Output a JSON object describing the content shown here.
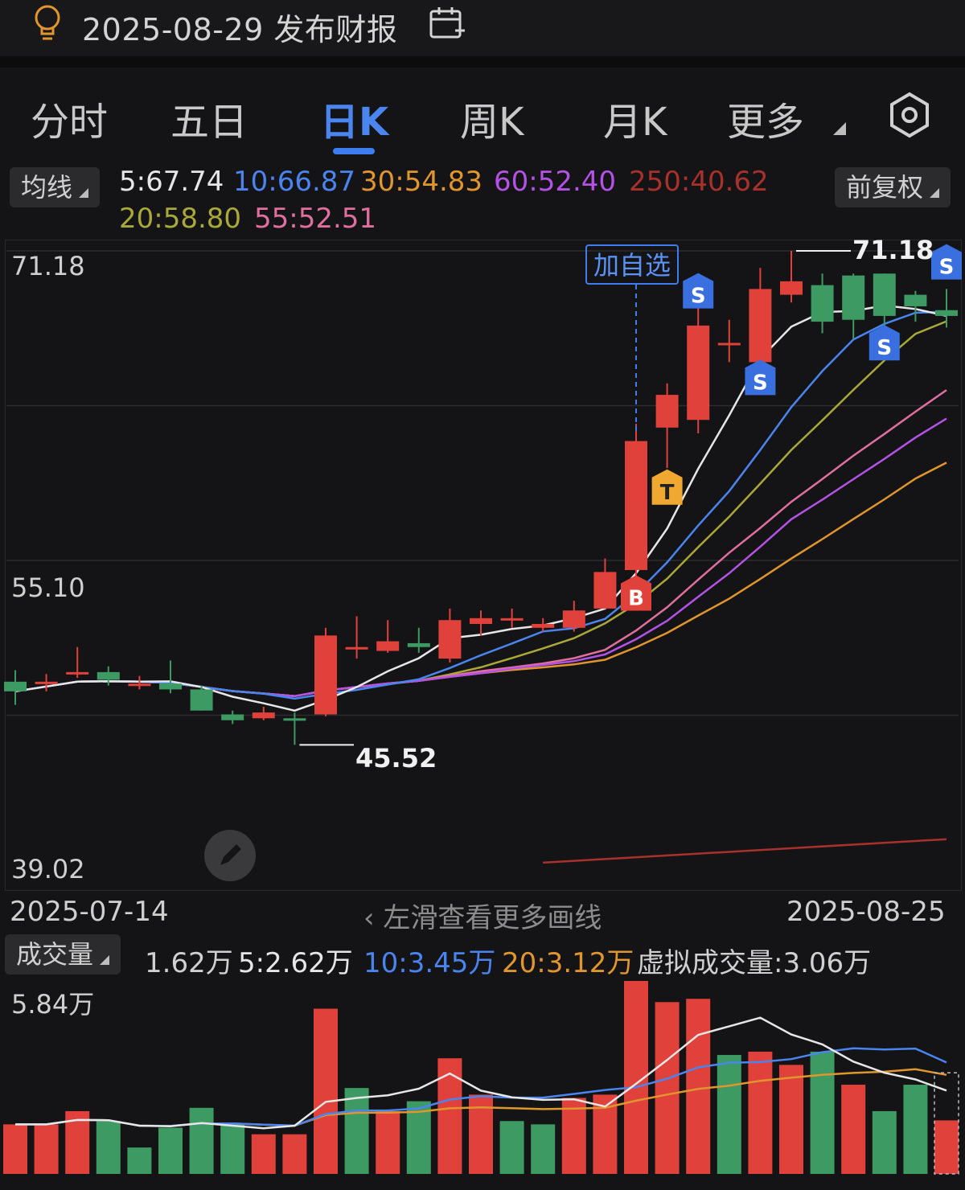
{
  "header": {
    "report_text": "2025-08-29 发布财报"
  },
  "tabs": [
    {
      "label": "分时"
    },
    {
      "label": "五日"
    },
    {
      "label": "日K"
    },
    {
      "label": "周K"
    },
    {
      "label": "月K"
    },
    {
      "label": "更多"
    }
  ],
  "ma": {
    "selector_label": "均线",
    "values": [
      {
        "text": "5:67.74",
        "color": "#e6e6e6"
      },
      {
        "text": "10:66.87",
        "color": "#4a84ee"
      },
      {
        "text": "30:54.83",
        "color": "#e0962c"
      },
      {
        "text": "60:52.40",
        "color": "#b452e6"
      },
      {
        "text": "250:40.62",
        "color": "#a8312c"
      },
      {
        "text": "20:58.80",
        "color": "#aaa838"
      },
      {
        "text": "55:52.51",
        "color": "#e06fa0"
      }
    ],
    "adjust_label": "前复权"
  },
  "price_axis": {
    "top": "71.18",
    "mid": "55.10",
    "bottom": "39.02"
  },
  "price_marks": {
    "high": "71.18",
    "low": "45.52",
    "add_watchlist": "加自选"
  },
  "signals": [
    "S",
    "S",
    "S",
    "S",
    "T",
    "B"
  ],
  "dates": {
    "start": "2025-07-14",
    "end": "2025-08-25"
  },
  "hint": "左滑查看更多画线",
  "volume": {
    "selector_label": "成交量",
    "current": "1.62万",
    "ma5": "5:2.62万",
    "ma10": "10:3.45万",
    "ma20": "20:3.12万",
    "virtual": "虚拟成交量:3.06万",
    "max_label": "5.84万"
  },
  "chart_data": {
    "type": "candlestick",
    "y_range": [
      39.02,
      71.18
    ],
    "x_range": [
      "2025-07-14",
      "2025-08-25"
    ],
    "candles": [
      {
        "o": 48.8,
        "c": 48.3,
        "h": 49.4,
        "l": 47.6
      },
      {
        "o": 48.8,
        "c": 48.8,
        "h": 49.2,
        "l": 48.3
      },
      {
        "o": 49.3,
        "c": 49.3,
        "h": 50.6,
        "l": 49.0
      },
      {
        "o": 49.3,
        "c": 48.9,
        "h": 49.6,
        "l": 48.6
      },
      {
        "o": 48.7,
        "c": 48.7,
        "h": 49.1,
        "l": 48.4
      },
      {
        "o": 48.7,
        "c": 48.4,
        "h": 49.9,
        "l": 48.2
      },
      {
        "o": 48.4,
        "c": 47.3,
        "h": 48.6,
        "l": 47.3
      },
      {
        "o": 47.1,
        "c": 46.8,
        "h": 47.3,
        "l": 46.6
      },
      {
        "o": 46.9,
        "c": 47.2,
        "h": 47.5,
        "l": 46.8
      },
      {
        "o": 46.9,
        "c": 46.8,
        "h": 47.2,
        "l": 45.52
      },
      {
        "o": 47.1,
        "c": 51.2,
        "h": 51.6,
        "l": 47.0
      },
      {
        "o": 50.5,
        "c": 50.6,
        "h": 52.2,
        "l": 50.0
      },
      {
        "o": 50.4,
        "c": 50.9,
        "h": 52.0,
        "l": 50.3
      },
      {
        "o": 50.8,
        "c": 50.6,
        "h": 51.6,
        "l": 50.3
      },
      {
        "o": 50.0,
        "c": 52.0,
        "h": 52.6,
        "l": 49.8
      },
      {
        "o": 51.8,
        "c": 52.1,
        "h": 52.5,
        "l": 51.2
      },
      {
        "o": 52.1,
        "c": 52.1,
        "h": 52.6,
        "l": 51.6
      },
      {
        "o": 51.6,
        "c": 51.8,
        "h": 52.1,
        "l": 51.4
      },
      {
        "o": 51.6,
        "c": 52.5,
        "h": 53.0,
        "l": 51.4
      },
      {
        "o": 52.6,
        "c": 54.5,
        "h": 55.2,
        "l": 52.6
      },
      {
        "o": 54.6,
        "c": 61.3,
        "h": 62.2,
        "l": 54.3
      },
      {
        "o": 62.0,
        "c": 63.7,
        "h": 64.3,
        "l": 59.9
      },
      {
        "o": 62.4,
        "c": 67.3,
        "h": 68.3,
        "l": 61.7
      },
      {
        "o": 66.4,
        "c": 66.4,
        "h": 67.6,
        "l": 65.4
      },
      {
        "o": 65.4,
        "c": 69.2,
        "h": 70.3,
        "l": 64.8
      },
      {
        "o": 68.9,
        "c": 69.6,
        "h": 71.18,
        "l": 68.5
      },
      {
        "o": 69.4,
        "c": 67.5,
        "h": 70.0,
        "l": 66.9
      },
      {
        "o": 69.9,
        "c": 67.6,
        "h": 70.0,
        "l": 66.6
      },
      {
        "o": 70.0,
        "c": 67.8,
        "h": 70.0,
        "l": 67.3
      },
      {
        "o": 68.9,
        "c": 68.3,
        "h": 69.1,
        "l": 67.5
      },
      {
        "o": 68.1,
        "c": 67.8,
        "h": 69.2,
        "l": 67.2
      }
    ],
    "volumes": [
      {
        "v": 1.5,
        "up": true
      },
      {
        "v": 1.5,
        "up": true
      },
      {
        "v": 1.9,
        "up": true
      },
      {
        "v": 1.6,
        "up": false
      },
      {
        "v": 0.8,
        "up": false
      },
      {
        "v": 1.4,
        "up": false
      },
      {
        "v": 2.0,
        "up": false
      },
      {
        "v": 1.5,
        "up": false
      },
      {
        "v": 1.2,
        "up": true
      },
      {
        "v": 1.2,
        "up": true
      },
      {
        "v": 5.0,
        "up": true
      },
      {
        "v": 2.6,
        "up": false
      },
      {
        "v": 1.9,
        "up": true
      },
      {
        "v": 2.2,
        "up": false
      },
      {
        "v": 3.5,
        "up": true
      },
      {
        "v": 2.4,
        "up": true
      },
      {
        "v": 1.6,
        "up": false
      },
      {
        "v": 1.5,
        "up": false
      },
      {
        "v": 2.3,
        "up": true
      },
      {
        "v": 2.4,
        "up": true
      },
      {
        "v": 5.84,
        "up": true
      },
      {
        "v": 5.2,
        "up": true
      },
      {
        "v": 5.3,
        "up": true
      },
      {
        "v": 3.6,
        "up": false
      },
      {
        "v": 3.7,
        "up": true
      },
      {
        "v": 3.3,
        "up": true
      },
      {
        "v": 3.7,
        "up": false
      },
      {
        "v": 2.7,
        "up": true
      },
      {
        "v": 1.9,
        "up": false
      },
      {
        "v": 2.7,
        "up": false
      },
      {
        "v": 1.62,
        "up": true
      }
    ]
  },
  "colors": {
    "up": "#e0413a",
    "down": "#3d9a62",
    "accent": "#4b86f0",
    "signal_s": "#3a6fe0",
    "signal_t": "#f0a830",
    "signal_b": "#e0413a"
  }
}
